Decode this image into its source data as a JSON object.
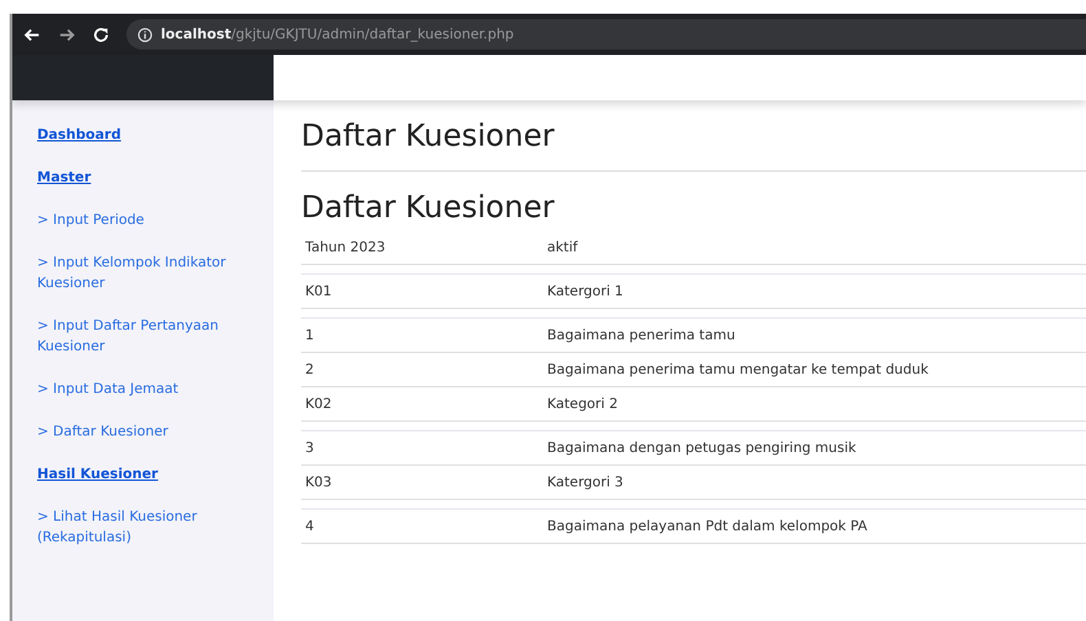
{
  "browser": {
    "address_host": "localhost",
    "address_path": "/gkjtu/GKJTU/admin/daftar_kuesioner.php"
  },
  "sidebar": {
    "items": [
      {
        "kind": "heading",
        "label": "Dashboard"
      },
      {
        "kind": "heading",
        "label": "Master"
      },
      {
        "kind": "link",
        "label": "> Input Periode"
      },
      {
        "kind": "link",
        "label": "> Input Kelompok Indikator Kuesioner"
      },
      {
        "kind": "link",
        "label": "> Input Daftar Pertanyaan Kuesioner"
      },
      {
        "kind": "link",
        "label": "> Input Data Jemaat"
      },
      {
        "kind": "link",
        "label": "> Daftar Kuesioner"
      },
      {
        "kind": "heading",
        "label": "Hasil Kuesioner"
      },
      {
        "kind": "link",
        "label": "> Lihat Hasil Kuesioner (Rekapitulasi)"
      }
    ]
  },
  "page_title": "Daftar Kuesioner",
  "section_title": "Daftar Kuesioner",
  "tables": [
    {
      "rows": [
        [
          "Tahun 2023",
          "aktif"
        ]
      ]
    },
    {
      "rows": [
        [
          "K01",
          "Katergori 1"
        ]
      ]
    },
    {
      "rows": [
        [
          "1",
          "Bagaimana penerima tamu"
        ],
        [
          "2",
          "Bagaimana penerima tamu mengatar ke tempat duduk"
        ],
        [
          "K02",
          "Kategori 2"
        ]
      ]
    },
    {
      "rows": [
        [
          "3",
          "Bagaimana dengan petugas pengiring musik"
        ],
        [
          "K03",
          "Katergori 3"
        ]
      ]
    },
    {
      "rows": [
        [
          "4",
          "Bagaimana pelayanan Pdt dalam  kelompok PA"
        ]
      ]
    }
  ]
}
